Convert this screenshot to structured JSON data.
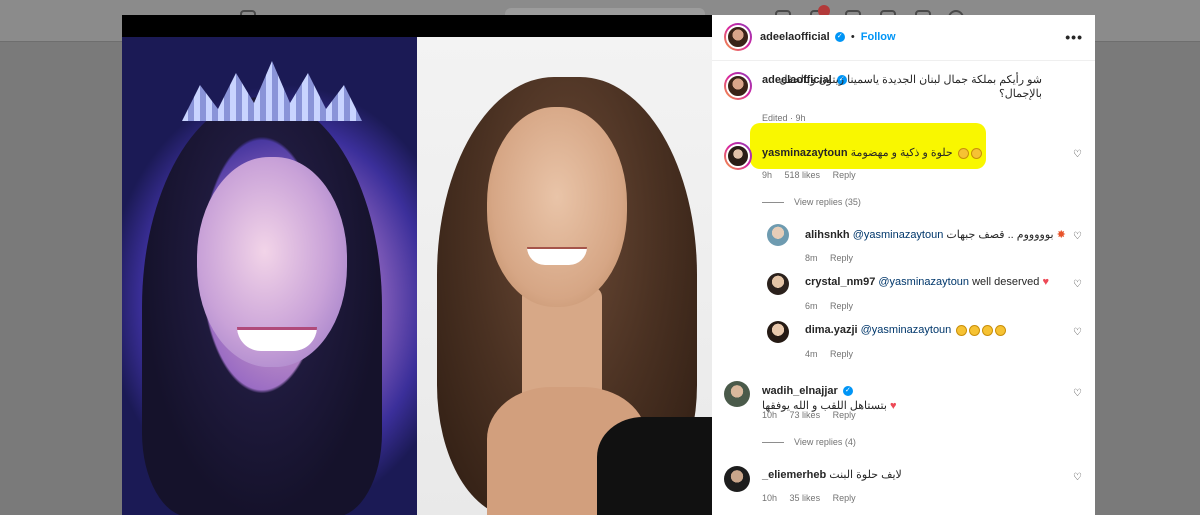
{
  "post": {
    "author": "adeelaofficial",
    "follow_label": "Follow",
    "more_label": "•••",
    "caption": "شو رأيكم بملكة جمال لبنان الجديدة ياسمينا زيتون وبالحفل بالإجمال؟",
    "caption_time": "Edited · 9h"
  },
  "comments": [
    {
      "user": "yasminazaytoun",
      "text": "حلوة و ذكية و مهضومة",
      "time": "9h",
      "likes": "518 likes",
      "reply": "Reply",
      "view_replies": "View replies (35)",
      "replies": [
        {
          "user": "alihsnkh",
          "mention": "@yasminazaytoun",
          "text": "بوووووم .. قصف جبهات",
          "time": "8m",
          "reply": "Reply"
        },
        {
          "user": "crystal_nm97",
          "mention": "@yasminazaytoun",
          "text": "well deserved",
          "time": "6m",
          "reply": "Reply"
        },
        {
          "user": "dima.yazji",
          "mention": "@yasminazaytoun",
          "text": "",
          "time": "4m",
          "reply": "Reply"
        }
      ]
    },
    {
      "user": "wadih_elnajjar",
      "text": "بتستاهل اللقب و الله يوفقها",
      "time": "10h",
      "likes": "73 likes",
      "reply": "Reply",
      "view_replies": "View replies (4)"
    },
    {
      "user": "_eliemerheb",
      "text": "لايف حلوة البنت",
      "time": "10h",
      "likes": "35 likes",
      "reply": "Reply"
    }
  ],
  "colors": {
    "accent": "#0095f6",
    "highlight": "#f9f700",
    "heart_red": "#ed4956"
  }
}
